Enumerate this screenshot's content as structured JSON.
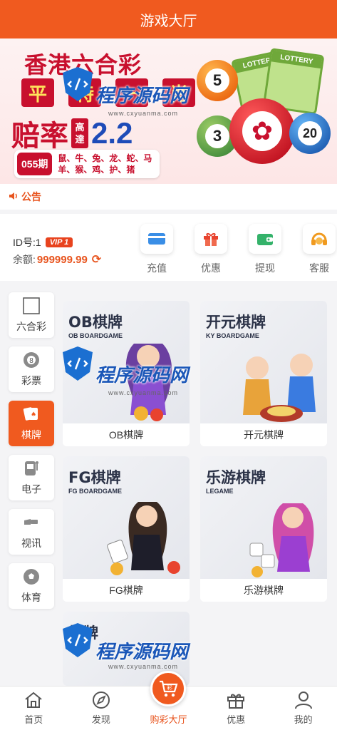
{
  "header": {
    "title": "游戏大厅"
  },
  "banner": {
    "line1": "香港六合彩",
    "chars": [
      "平",
      "特",
      "一",
      "肖"
    ],
    "odds_label": "赔率",
    "high_label": "高達",
    "odds_value": "2.2",
    "issue": "055期",
    "zodiac_row1": "鼠、牛、兔、龙、蛇、马",
    "zodiac_row2": "羊、猴、鸡、护、猪",
    "ticket_label": "LOTTERY",
    "ball_numbers": [
      "5",
      "3",
      "20"
    ]
  },
  "notice": {
    "label": "公告"
  },
  "account": {
    "id_label": "ID号:1",
    "vip": "VIP 1",
    "balance_label": "余额:",
    "balance_value": "999999.99",
    "actions": [
      {
        "label": "充值",
        "icon": "card-icon",
        "color": "#3a8ee6"
      },
      {
        "label": "优惠",
        "icon": "gift-icon",
        "color": "#e8432e"
      },
      {
        "label": "提现",
        "icon": "wallet-icon",
        "color": "#34b26a"
      },
      {
        "label": "客服",
        "icon": "headset-icon",
        "color": "#f09a1f"
      }
    ]
  },
  "sidenav": [
    {
      "label": "六合彩",
      "icon": "square-icon"
    },
    {
      "label": "彩票",
      "icon": "lottery-ball-icon"
    },
    {
      "label": "棋牌",
      "icon": "cards-icon",
      "active": true
    },
    {
      "label": "电子",
      "icon": "slot-machine-icon"
    },
    {
      "label": "视讯",
      "icon": "camera-icon"
    },
    {
      "label": "体育",
      "icon": "soccer-ball-icon"
    }
  ],
  "games": [
    {
      "title": "OB棋牌",
      "sub": "OB BOARDGAME",
      "name": "OB棋牌"
    },
    {
      "title": "开元棋牌",
      "sub": "KY BOARDGAME",
      "name": "开元棋牌"
    },
    {
      "title": "FG棋牌",
      "sub": "FG BOARDGAME",
      "name": "FG棋牌"
    },
    {
      "title": "乐游棋牌",
      "sub": "LEGAME",
      "name": "乐游棋牌"
    },
    {
      "title": "棋牌",
      "sub": "",
      "name": ""
    }
  ],
  "watermark": {
    "text": "程序源码网",
    "url": "www.cxyuanma.com"
  },
  "bottombar": [
    {
      "label": "首页",
      "icon": "home-icon"
    },
    {
      "label": "发现",
      "icon": "compass-icon"
    },
    {
      "label": "购彩大厅",
      "icon": "lottery-hall-icon",
      "active": true,
      "fab_label": "彩"
    },
    {
      "label": "优惠",
      "icon": "gift-icon"
    },
    {
      "label": "我的",
      "icon": "user-icon"
    }
  ],
  "colors": {
    "brand": "#f05a1f",
    "accent_blue": "#1e4bb8",
    "banner_red": "#c8102e"
  }
}
